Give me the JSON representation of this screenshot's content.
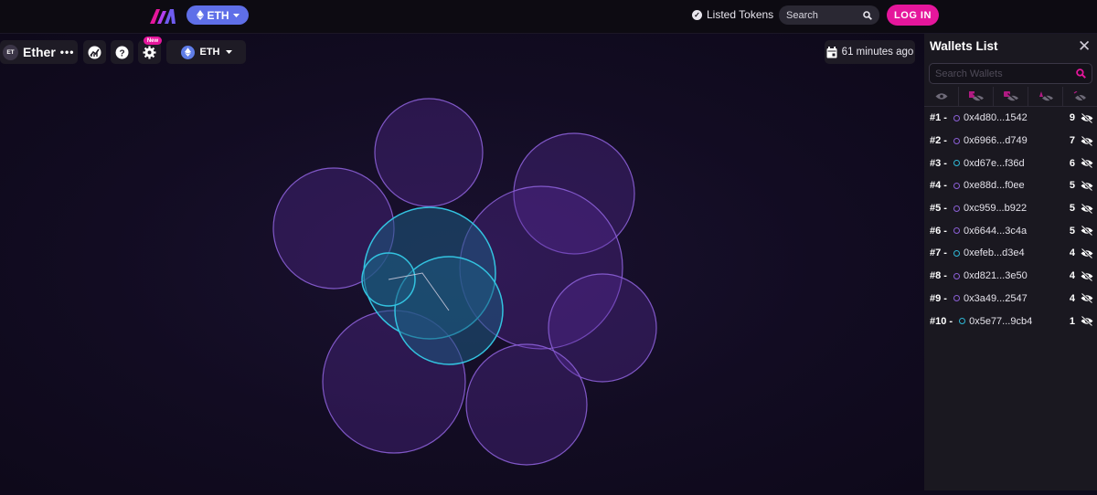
{
  "header": {
    "network_label": "ETH",
    "listed_tokens_label": "Listed Tokens",
    "search_placeholder": "Search",
    "login_label": "LOG IN"
  },
  "toolbar": {
    "token_badge": "ET",
    "token_name": "Ether",
    "more_label": "•••",
    "new_badge": "New",
    "chain_label": "ETH",
    "updated_label": "61 minutes ago"
  },
  "wallet_panel": {
    "title": "Wallets List",
    "search_placeholder": "Search Wallets",
    "wallets": [
      {
        "rank": "#1 -",
        "address": "0x4d80...1542",
        "count": "9",
        "color": "#8b5fd6"
      },
      {
        "rank": "#2 -",
        "address": "0x6966...d749",
        "count": "7",
        "color": "#8b5fd6"
      },
      {
        "rank": "#3 -",
        "address": "0xd67e...f36d",
        "count": "6",
        "color": "#2fb8d6"
      },
      {
        "rank": "#4 -",
        "address": "0xe88d...f0ee",
        "count": "5",
        "color": "#8b5fd6"
      },
      {
        "rank": "#5 -",
        "address": "0xc959...b922",
        "count": "5",
        "color": "#8b5fd6"
      },
      {
        "rank": "#6 -",
        "address": "0x6644...3c4a",
        "count": "5",
        "color": "#8b5fd6"
      },
      {
        "rank": "#7 -",
        "address": "0xefeb...d3e4",
        "count": "4",
        "color": "#2fb8d6"
      },
      {
        "rank": "#8 -",
        "address": "0xd821...3e50",
        "count": "4",
        "color": "#8b5fd6"
      },
      {
        "rank": "#9 -",
        "address": "0x3a49...2547",
        "count": "4",
        "color": "#8b5fd6"
      },
      {
        "rank": "#10 -",
        "address": "0x5e77...9cb4",
        "count": "1",
        "color": "#2fb8d6"
      }
    ]
  },
  "colors": {
    "accent_pink": "#e5169c",
    "network_blue": "#5f6fe8",
    "bubble_purple": "#8b5fd6",
    "bubble_cyan": "#2fb8d6"
  }
}
